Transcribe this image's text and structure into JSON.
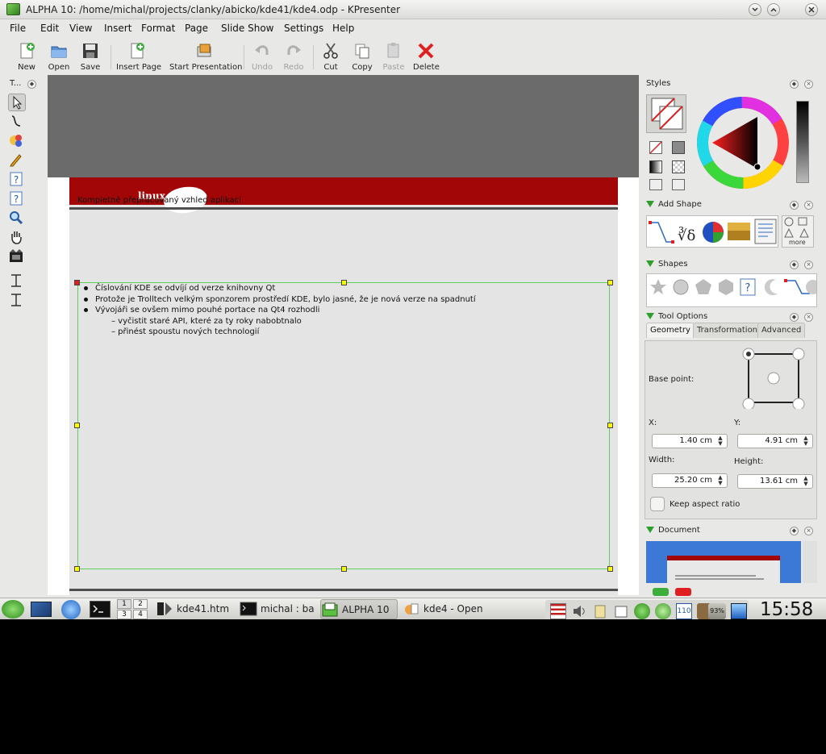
{
  "window": {
    "title": "ALPHA 10: /home/michal/projects/clanky/abicko/kde41/kde4.odp - KPresenter"
  },
  "menu": [
    "File",
    "Edit",
    "View",
    "Insert",
    "Format",
    "Page",
    "Slide Show",
    "Settings",
    "Help"
  ],
  "toolbar": {
    "new": "New",
    "open": "Open",
    "save": "Save",
    "insert_page": "Insert Page",
    "start_presentation": "Start Presentation",
    "undo": "Undo",
    "redo": "Redo",
    "cut": "Cut",
    "copy": "Copy",
    "paste": "Paste",
    "delete": "Delete"
  },
  "tool_dock": {
    "title": "T..."
  },
  "slide": {
    "title": "Kompletně přepracovaný vzhled aplikací",
    "logo": "linux xalt",
    "bullets": [
      "Číslování KDE se odvíjí od verze knihovny Qt",
      "Protože je Trolltech velkým sponzorem prostředí KDE, bylo jasné, že je nová verze na spadnutí",
      "Vývojáři se ovšem mimo pouhé portace na Qt4 rozhodli"
    ],
    "subitems": [
      "– vyčistit staré API, které za ty roky nabobtnalo",
      "– přinést spoustu nových technologií"
    ]
  },
  "panels": {
    "styles": {
      "title": "Styles"
    },
    "add_shape": {
      "title": "Add Shape",
      "more": "more"
    },
    "shapes": {
      "title": "Shapes"
    },
    "tool_options": {
      "title": "Tool Options",
      "tabs": [
        "Geometry",
        "Transformation",
        "Advanced"
      ],
      "base_point": "Base point:",
      "x_label": "X:",
      "y_label": "Y:",
      "x_value": "1.40 cm",
      "y_value": "4.91 cm",
      "width_label": "Width:",
      "height_label": "Height:",
      "width_value": "25.20 cm",
      "height_value": "13.61 cm",
      "keep_aspect": "Keep aspect ratio"
    },
    "document": {
      "title": "Document"
    }
  },
  "taskbar": {
    "pager": [
      "1",
      "2",
      "3",
      "4"
    ],
    "tasks": [
      "kde41.htm",
      "michal : ba",
      "ALPHA 10",
      "kde4 - Open"
    ],
    "battery": "93%",
    "tray_badge": "110",
    "clock": "15:58"
  },
  "colors": {
    "accent": "#2e9e2e",
    "slide_header": "#a30606",
    "selection": "#5fd05f"
  }
}
